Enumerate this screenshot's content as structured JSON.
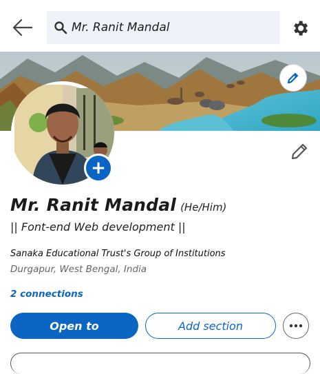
{
  "search": {
    "value": "Mr. Ranit Mandal"
  },
  "profile": {
    "name": "Mr. Ranit Mandal",
    "pronouns": "(He/Him)",
    "headline": "|| Font-end Web development ||",
    "education": "Sanaka Educational Trust's Group of Institutions",
    "location": "Durgapur, West Bengal, India",
    "connections": "2 connections"
  },
  "actions": {
    "open_to": "Open to",
    "add_section": "Add section"
  },
  "icons": {
    "back": "arrow-left-icon",
    "search": "search-icon",
    "settings": "gear-icon",
    "edit": "pencil-icon",
    "add": "plus-icon",
    "more": "more-horizontal-icon"
  },
  "colors": {
    "accent": "#0a66c2",
    "search_bg": "#edf3f8"
  }
}
